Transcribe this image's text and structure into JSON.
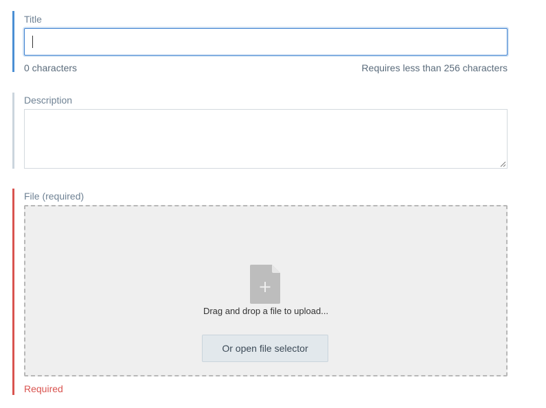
{
  "title_field": {
    "label": "Title",
    "value": "",
    "char_count": "0 characters",
    "limit_hint": "Requires less than 256 characters",
    "accent_color": "#4a8fd4"
  },
  "description_field": {
    "label": "Description",
    "value": "",
    "accent_color": "#cbd5dd"
  },
  "file_field": {
    "label": "File (required)",
    "drop_text": "Drag and drop a file to upload...",
    "open_button_label": "Or open file selector",
    "icon": "file-add-icon",
    "error": "Required",
    "accent_color": "#d9534f"
  }
}
